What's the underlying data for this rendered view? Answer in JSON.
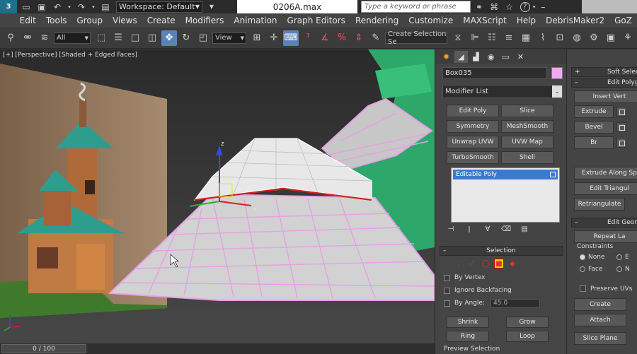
{
  "titlebar": {
    "workspace": "Workspace: Default",
    "file_title": "0206A.max",
    "search_placeholder": "Type a keyword or phrase",
    "user_label": "DebrisMaker2"
  },
  "menu": [
    "Edit",
    "Tools",
    "Group",
    "Views",
    "Create",
    "Modifiers",
    "Animation",
    "Graph Editors",
    "Rendering",
    "Customize",
    "MAXScript",
    "Help",
    "DebrisMaker2",
    "GoZ"
  ],
  "toolbar": {
    "filter_select": "All",
    "ref_coord_select": "View",
    "named_selection": "Create Selection Se"
  },
  "viewport": {
    "label": "[+] [Perspective] [Shaded + Edged Faces]",
    "axis_z": "z",
    "axis_x": "x"
  },
  "timebar": {
    "frame": "0 / 100"
  },
  "command_panel": {
    "object_name": "Box035",
    "object_color": "#f2a9f2",
    "modifier_list": "Modifier List",
    "buttons": [
      "Edit Poly",
      "Slice",
      "Symmetry",
      "MeshSmooth",
      "Unwrap UVW",
      "UVW Map",
      "TurboSmooth",
      "Shell"
    ],
    "stack_item": "Editable Poly",
    "selection": {
      "title": "Selection",
      "by_vertex": "By Vertex",
      "ignore_backfacing": "Ignore Backfacing",
      "by_angle": "By Angle:",
      "angle_value": "45.0",
      "shrink": "Shrink",
      "grow": "Grow",
      "ring": "Ring",
      "loop": "Loop",
      "preview_selection": "Preview Selection"
    }
  },
  "edit_panel": {
    "soft_selection": "Soft Select",
    "edit_polygons": "Edit Polyg",
    "insert_vertex": "Insert Vert",
    "extrude": "Extrude",
    "bevel": "Bevel",
    "bridge": "Br",
    "extrude_along_spline": "Extrude Along Sp",
    "edit_triangulation": "Edit Triangul",
    "retriangulate": "Retriangulate",
    "edit_geometry": "Edit Geom",
    "repeat_last": "Repeat La",
    "constraints": "Constraints",
    "none": "None",
    "edge": "E",
    "face": "Face",
    "normal": "N",
    "preserve_uvs": "Preserve UVs",
    "create": "Create",
    "attach": "Attach",
    "slice_plane": "Slice Plane"
  },
  "colors": {
    "selection_highlight": "#3a7ad1",
    "object_wire": "#e6a0e6",
    "green_geometry": "#2ea86a"
  }
}
